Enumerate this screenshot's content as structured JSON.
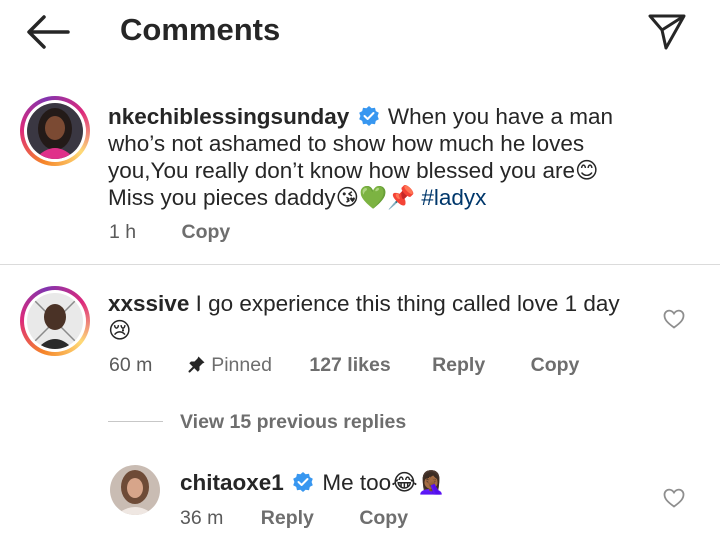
{
  "header": {
    "title": "Comments"
  },
  "post": {
    "username": "nkechiblessingsunday",
    "text_before_tag": "When you have a man who’s not ashamed to show how much he loves you,You really don’t know how blessed you are😊 Miss you pieces daddy😘💚📌 ",
    "hashtag": "#ladyx",
    "time": "1 h",
    "copy_label": "Copy"
  },
  "comment": {
    "username": "xxssive",
    "text": "I go experience this thing called love 1 day 😢",
    "time": "60 m",
    "pinned_label": "Pinned",
    "likes_label": "127 likes",
    "reply_label": "Reply",
    "copy_label": "Copy"
  },
  "view_replies": "View 15 previous replies",
  "reply": {
    "username": "chitaoxe1",
    "text": "Me too😂🤦🏾‍♀️",
    "time": "36 m",
    "reply_label": "Reply",
    "copy_label": "Copy"
  },
  "colors": {
    "text": "#262626",
    "meta": "#6e6e6e",
    "verified": "#3897f0",
    "hashtag": "#00376b",
    "divider": "#dbdbdb"
  }
}
